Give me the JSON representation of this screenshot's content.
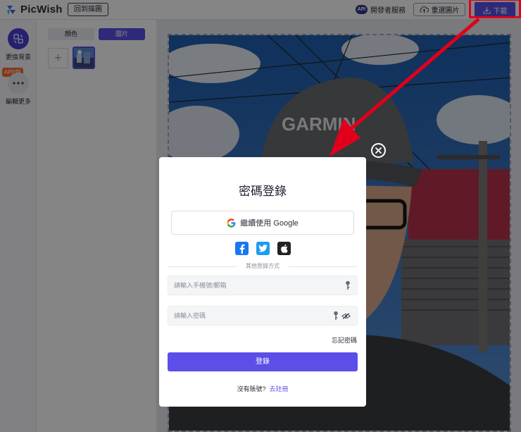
{
  "header": {
    "brand": "PicWish",
    "back_label": "回到摳圖",
    "api_badge": "API",
    "developer_label": "開發者服務",
    "reselect_label": "重選圖片",
    "download_label": "下載"
  },
  "rail": {
    "items": [
      {
        "label": "更換背景",
        "icon": "swap-background-icon"
      },
      {
        "label": "編輯更多",
        "icon": "more-icon"
      }
    ],
    "app_badge": "APP版"
  },
  "panel": {
    "tabs": [
      {
        "label": "顏色",
        "active": false
      },
      {
        "label": "圖片",
        "active": true
      }
    ],
    "add_icon": "plus-icon"
  },
  "canvas": {
    "cap_text": "GARMIN"
  },
  "modal": {
    "title": "密碼登錄",
    "google_label": "繼續使用 Google",
    "social_icons": [
      "facebook-icon",
      "twitter-icon",
      "apple-icon"
    ],
    "divider_text": "其他登錄方式",
    "account_placeholder": "請輸入手機號/郵箱",
    "password_placeholder": "請輸入密碼",
    "forgot_label": "忘記密碼",
    "login_label": "登錄",
    "no_account_text": "沒有賬號?",
    "register_label": "去註冊"
  },
  "colors": {
    "accent": "#5b4fe8",
    "annotation_red": "#e0001b"
  }
}
